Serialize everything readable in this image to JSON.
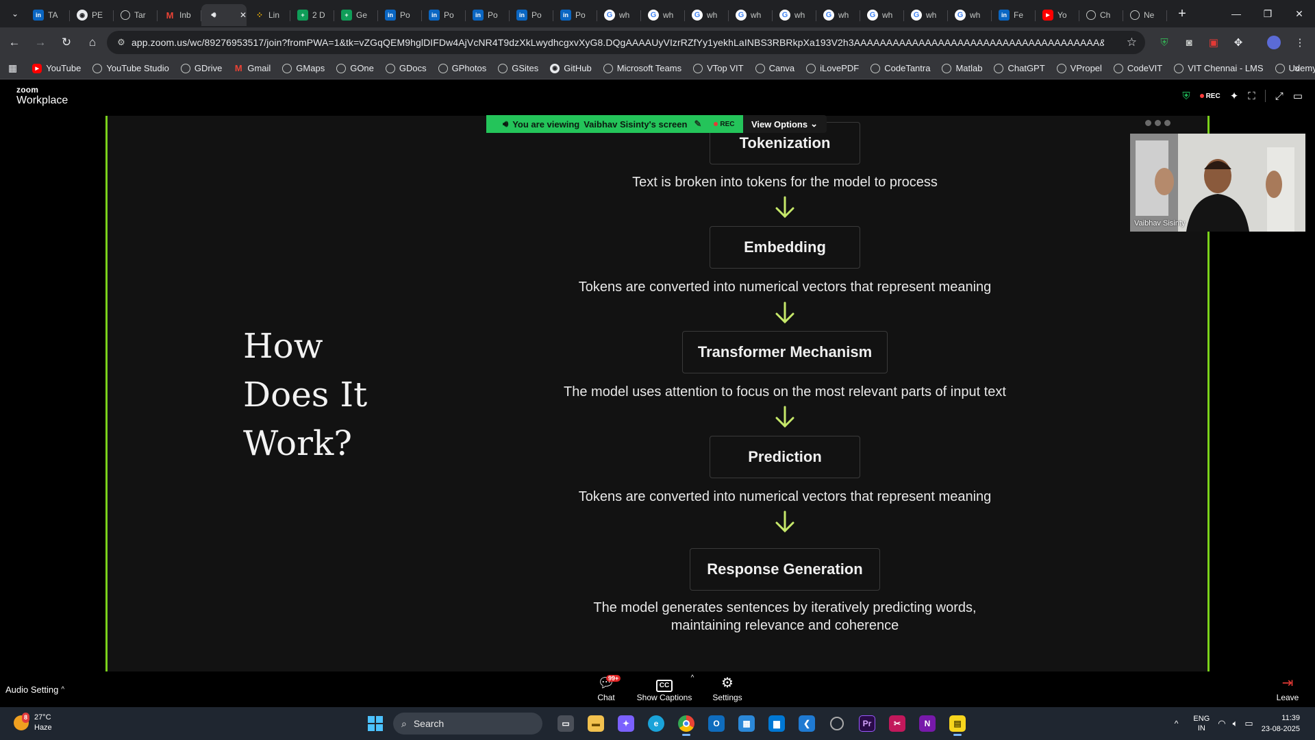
{
  "browser": {
    "tabs": [
      {
        "label": "TA",
        "icon": "linkedin-icon",
        "kind": "li"
      },
      {
        "label": "PE",
        "icon": "github-icon",
        "kind": "gh"
      },
      {
        "label": "Tar",
        "icon": "web-icon",
        "kind": "wb"
      },
      {
        "label": "Inb",
        "icon": "gmail-icon",
        "kind": "gm"
      },
      {
        "label": "",
        "icon": "speaker-icon",
        "kind": "snd",
        "active": true
      },
      {
        "label": "Lin",
        "icon": "dots-icon",
        "kind": "dots"
      },
      {
        "label": "2 D",
        "icon": "sheets-icon",
        "kind": "gs"
      },
      {
        "label": "Ge",
        "icon": "sheets-icon",
        "kind": "gs"
      },
      {
        "label": "Po",
        "icon": "linkedin-icon",
        "kind": "li"
      },
      {
        "label": "Po",
        "icon": "linkedin-icon",
        "kind": "li"
      },
      {
        "label": "Po",
        "icon": "linkedin-icon",
        "kind": "li"
      },
      {
        "label": "Po",
        "icon": "linkedin-icon",
        "kind": "li"
      },
      {
        "label": "Po",
        "icon": "linkedin-icon",
        "kind": "li"
      },
      {
        "label": "wh",
        "icon": "google-icon",
        "kind": "gl"
      },
      {
        "label": "wh",
        "icon": "google-icon",
        "kind": "gl"
      },
      {
        "label": "wh",
        "icon": "google-icon",
        "kind": "gl"
      },
      {
        "label": "wh",
        "icon": "google-icon",
        "kind": "gl"
      },
      {
        "label": "wh",
        "icon": "google-icon",
        "kind": "gl"
      },
      {
        "label": "wh",
        "icon": "google-icon",
        "kind": "gl"
      },
      {
        "label": "wh",
        "icon": "google-icon",
        "kind": "gl"
      },
      {
        "label": "wh",
        "icon": "google-icon",
        "kind": "gl"
      },
      {
        "label": "wh",
        "icon": "google-icon",
        "kind": "gl"
      },
      {
        "label": "Fe",
        "icon": "linkedin-icon",
        "kind": "li"
      },
      {
        "label": "Yo",
        "icon": "youtube-icon",
        "kind": "yt"
      },
      {
        "label": "Ch",
        "icon": "chatgpt-icon",
        "kind": "wb"
      },
      {
        "label": "Ne",
        "icon": "web-icon",
        "kind": "wb"
      }
    ],
    "url": "app.zoom.us/wc/89276953517/join?fromPWA=1&tk=vZGqQEM9hglDIFDw4AjVcNR4T9dzXkLwydhcgxvXyG8.DQgAAAAUyVIzrRZfYy1yekhLaINBS3RBRkpXa193V2h3AAAAAAAAAAAAAAAAAAAAAAAAAAAAAAAAAAAAAA&_x_zm_r...",
    "bookmarks": [
      {
        "label": "YouTube",
        "kind": "yt"
      },
      {
        "label": "YouTube Studio",
        "kind": "wb"
      },
      {
        "label": "GDrive",
        "kind": "wb"
      },
      {
        "label": "Gmail",
        "kind": "gm"
      },
      {
        "label": "GMaps",
        "kind": "wb"
      },
      {
        "label": "GOne",
        "kind": "wb"
      },
      {
        "label": "GDocs",
        "kind": "wb"
      },
      {
        "label": "GPhotos",
        "kind": "wb"
      },
      {
        "label": "GSites",
        "kind": "wb"
      },
      {
        "label": "GitHub",
        "kind": "gh"
      },
      {
        "label": "Microsoft Teams",
        "kind": "wb"
      },
      {
        "label": "VTop VIT",
        "kind": "wb"
      },
      {
        "label": "Canva",
        "kind": "wb"
      },
      {
        "label": "iLovePDF",
        "kind": "wb"
      },
      {
        "label": "CodeTantra",
        "kind": "wb"
      },
      {
        "label": "Matlab",
        "kind": "wb"
      },
      {
        "label": "ChatGPT",
        "kind": "wb"
      },
      {
        "label": "VPropel",
        "kind": "wb"
      },
      {
        "label": "CodeVIT",
        "kind": "wb"
      },
      {
        "label": "VIT Chennai - LMS",
        "kind": "wb"
      },
      {
        "label": "Udemy",
        "kind": "wb"
      }
    ]
  },
  "zoom": {
    "logo_small": "zoom",
    "logo_large": "Workplace",
    "rec_label": "REC",
    "banner": {
      "prefix": "You are viewing",
      "presenter": "Vaibhav Sisinty's screen",
      "rec": "REC",
      "view_options": "View Options"
    },
    "self_view_name": "Vaibhav Sisinty",
    "bottom": {
      "audio_setting": "Audio Setting",
      "chat": "Chat",
      "chat_badge": "99+",
      "captions": "Show Captions",
      "settings": "Settings",
      "leave": "Leave"
    }
  },
  "slide": {
    "title_lines": [
      "How",
      "Does It",
      "Work?"
    ],
    "steps": [
      {
        "label": "Tokenization",
        "desc": "Text is broken into tokens for the model to process"
      },
      {
        "label": "Embedding",
        "desc": "Tokens are converted into numerical vectors that represent meaning"
      },
      {
        "label": "Transformer Mechanism",
        "desc": "The model uses attention to focus on the most relevant parts of input text"
      },
      {
        "label": "Prediction",
        "desc": "Tokens are converted into numerical vectors that represent meaning"
      },
      {
        "label": "Response Generation",
        "desc_lines": [
          "The model generates sentences by iteratively predicting words,",
          "maintaining relevance and coherence"
        ]
      }
    ],
    "arrow_color": "#c6e86a"
  },
  "taskbar": {
    "weather_temp": "27°C",
    "weather_desc": "Haze",
    "weather_badge": "8",
    "search_label": "Search",
    "lang_top": "ENG",
    "lang_bottom": "IN",
    "time": "11:39",
    "date": "23-08-2025"
  },
  "colors": {
    "share_border": "#7bd21b",
    "banner_green": "#24c45a",
    "rec_red": "#ff3b3b"
  }
}
